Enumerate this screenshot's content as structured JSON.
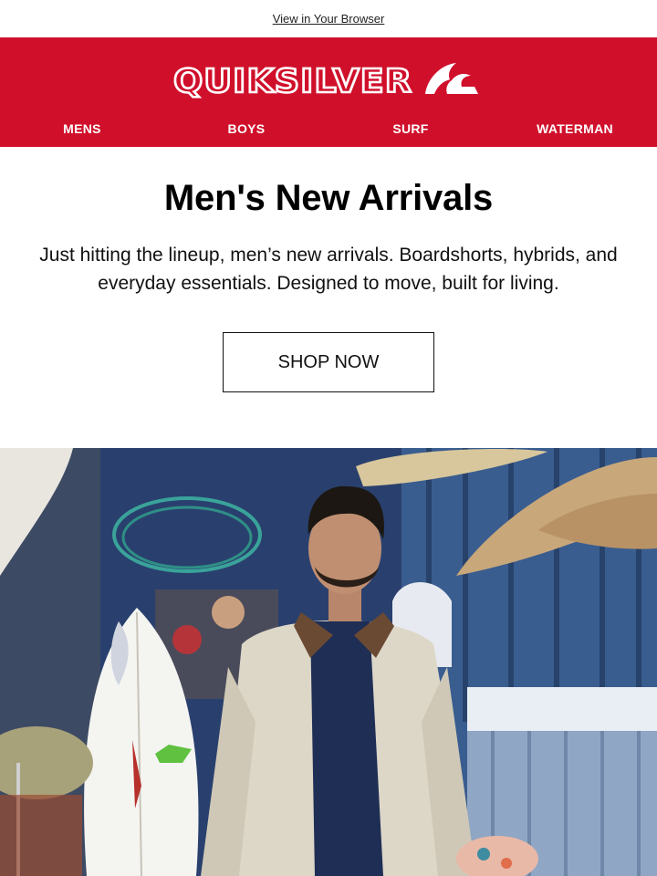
{
  "topbar": {
    "view_in_browser": "View in Your Browser"
  },
  "brand": {
    "name": "QUIKSILVER",
    "color": "#d0102b"
  },
  "nav": {
    "items": [
      "MENS",
      "BOYS",
      "SURF",
      "WATERMAN"
    ]
  },
  "hero": {
    "title": "Men's New Arrivals",
    "body": "Just hitting the lineup, men’s new arrivals. Boardshorts, hybrids, and everyday essentials. Designed to move, built for living.",
    "cta_label": "SHOP NOW"
  },
  "photo": {
    "subject": "man in white jacket standing in surf workshop with surfboards"
  }
}
